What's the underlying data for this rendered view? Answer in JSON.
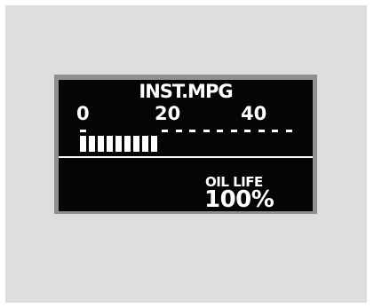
{
  "display": {
    "title": "INST.MPG",
    "gauge": {
      "tick_labels": [
        "0",
        "20",
        "40"
      ],
      "scale_max": 50,
      "fill_bar_count": 9,
      "total_bar_count": 19
    },
    "oil_life_label": "OIL LIFE",
    "oil_life_value": "100%"
  }
}
